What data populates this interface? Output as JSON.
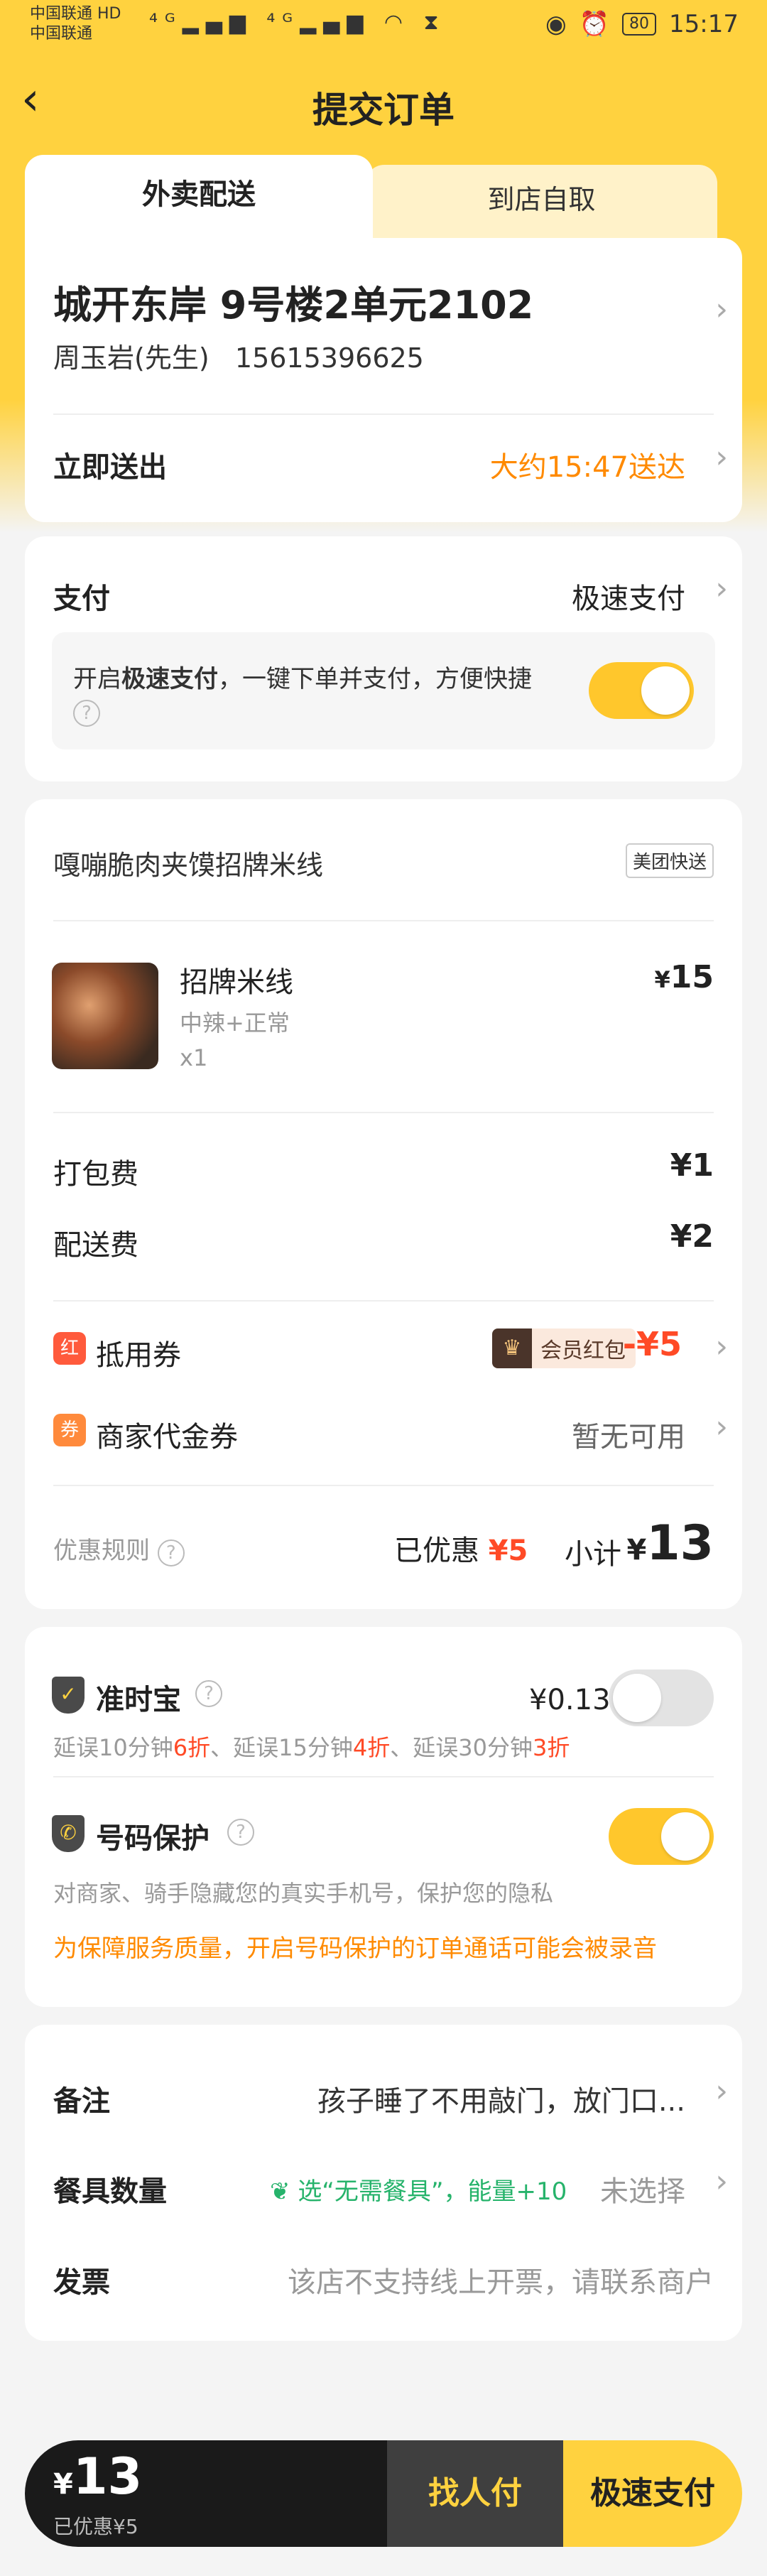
{
  "status": {
    "carrier1": "中国联通 HD",
    "carrier2": "中国联通",
    "signal_icons": "⁴ᴳ▂▄▆ ⁴ᴳ▂▄▆ ◠ ⧗",
    "battery": "80",
    "time": "15:17"
  },
  "nav": {
    "back": "‹",
    "title": "提交订单"
  },
  "tabs": {
    "delivery": "外卖配送",
    "pickup": "到店自取"
  },
  "address": {
    "line": "城开东岸 9号楼2单元2102",
    "name": "周玉岩(先生)",
    "phone": "15615396625",
    "send_label": "立即送出",
    "eta": "大约15:47送达"
  },
  "payment": {
    "label": "支付",
    "method": "极速支付",
    "fast_prefix": "开启",
    "fast_bold": "极速支付",
    "fast_suffix": "，一键下单并支付，方便快捷",
    "fast_on": true
  },
  "shop": {
    "name": "嘎嘣脆肉夹馍招牌米线",
    "delivery_tag": "美团快送",
    "item": {
      "name": "招牌米线",
      "spec": "中辣+正常",
      "qty": "x1",
      "price_sym": "¥",
      "price": "15"
    },
    "packing_label": "打包费",
    "packing_val": "¥1",
    "delivery_label": "配送费",
    "delivery_val": "¥2",
    "coupon_label": "抵用券",
    "coupon_icon": "红包",
    "member_badge": "会员红包",
    "member_amt": "-¥5",
    "voucher_label": "商家代金券",
    "voucher_icon": "券",
    "voucher_val": "暂无可用",
    "rule_label": "优惠规则",
    "saved_label": "已优惠",
    "saved_val": "¥5",
    "subtotal_label": "小计",
    "subtotal_sym": "¥",
    "subtotal_val": "13"
  },
  "insurance": {
    "ontime_label": "准时宝",
    "ontime_price": "¥0.13",
    "ontime_on": false,
    "ontime_p1": "延误10分钟",
    "ontime_d1": "6折",
    "ontime_p2": "、延误15分钟",
    "ontime_d2": "4折",
    "ontime_p3": "、延误30分钟",
    "ontime_d3": "3折",
    "phone_label": "号码保护",
    "phone_on": true,
    "phone_desc": "对商家、骑手隐藏您的真实手机号，保护您的隐私",
    "phone_warn": "为保障服务质量，开启号码保护的订单通话可能会被录音"
  },
  "notes": {
    "remark_label": "备注",
    "remark_val": "孩子睡了不用敲门，放门口...",
    "tableware_label": "餐具数量",
    "tableware_promo": "选“无需餐具”，能量+10",
    "tableware_val": "未选择",
    "invoice_label": "发票",
    "invoice_val": "该店不支持线上开票，请联系商户"
  },
  "bottom": {
    "total_sym": "¥",
    "total": "13",
    "saved": "已优惠¥5",
    "friend_pay": "找人付",
    "fast_pay": "极速支付"
  },
  "colors": {
    "brand_yellow": "#ffd23f",
    "orange": "#ff8a00",
    "red": "#ff4a26"
  }
}
